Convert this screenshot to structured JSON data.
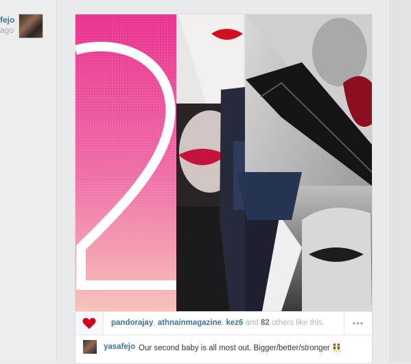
{
  "sidebar": {
    "username_partial": "fejo",
    "time_partial": "ago"
  },
  "post": {
    "likes": {
      "users": [
        "pandorajay",
        "athnainmagazine",
        "kez6"
      ],
      "connector": "and",
      "count": "82",
      "suffix": "others like this."
    },
    "more_label": "•••",
    "caption": {
      "username": "yasafejo",
      "text": "Our second baby is all most out. Bigger/better/stronger 👯"
    }
  },
  "colors": {
    "link": "#3f729b",
    "heart": "#d0021b"
  },
  "icons": {
    "like": "heart-icon",
    "more": "ellipsis-icon"
  }
}
